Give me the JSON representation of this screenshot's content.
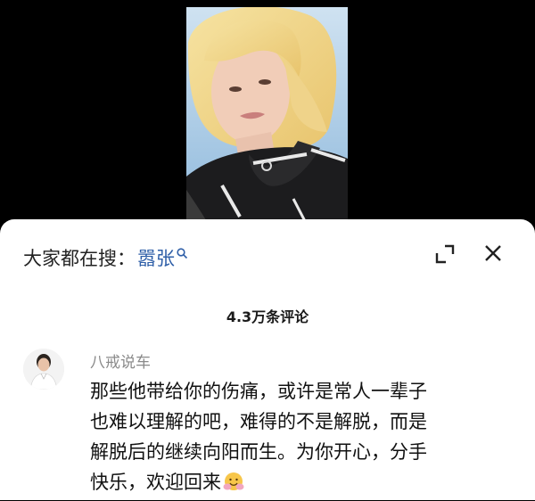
{
  "search_bar": {
    "prefix": "大家都在搜：",
    "term": "嚣张",
    "icon": "search-icon"
  },
  "header_actions": {
    "expand_icon": "expand-icon",
    "close_icon": "close-icon"
  },
  "comments": {
    "count_label": "4.3万条评论",
    "items": [
      {
        "username": "八戒说车",
        "text": "那些他带给你的伤痛，或许是常人一辈子\n也难以理解的吧，难得的不是解脱，而是\n解脱后的继续向阳而生。为你开心，分手\n快乐，欢迎回来",
        "emoji": "hug-emoji-icon"
      }
    ]
  },
  "colors": {
    "search_term": "#2f5fa8",
    "username": "#8a8a8a",
    "text": "#111111"
  }
}
